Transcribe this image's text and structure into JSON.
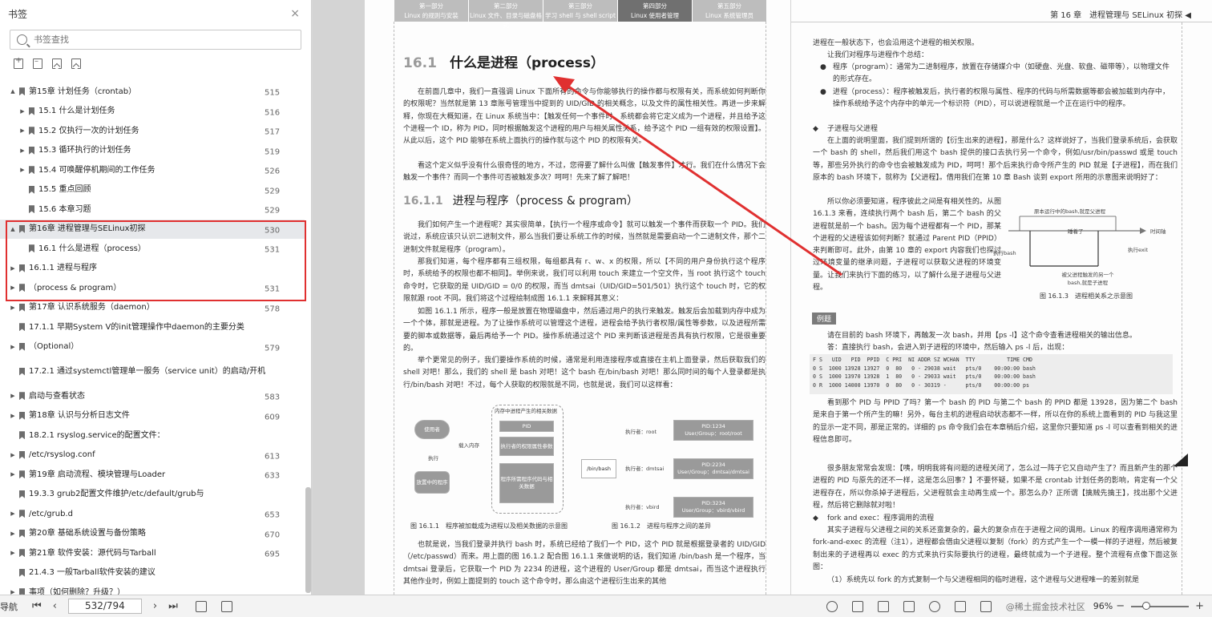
{
  "sidebar": {
    "title": "书签",
    "close_icon": "×",
    "search_placeholder": "书签查找",
    "toc": [
      {
        "title": "第15章 计划任务（crontab）",
        "page": "515",
        "level": 1,
        "twisty": "▲",
        "selected": false,
        "two": false
      },
      {
        "title": "15.1 什么是计划任务",
        "page": "516",
        "level": 2,
        "twisty": "▶",
        "selected": false,
        "two": false
      },
      {
        "title": "15.2 仅执行一次的计划任务",
        "page": "517",
        "level": 2,
        "twisty": "▶",
        "selected": false,
        "two": false
      },
      {
        "title": "15.3 循环执行的计划任务",
        "page": "519",
        "level": 2,
        "twisty": "▶",
        "selected": false,
        "two": false
      },
      {
        "title": "15.4 可唤醒停机期间的工作任务",
        "page": "526",
        "level": 2,
        "twisty": "▶",
        "selected": false,
        "two": false
      },
      {
        "title": "15.5 重点回顾",
        "page": "529",
        "level": 2,
        "twisty": "",
        "selected": false,
        "two": false
      },
      {
        "title": "15.6 本章习题",
        "page": "529",
        "level": 2,
        "twisty": "",
        "selected": false,
        "two": false
      },
      {
        "title": "第16章 进程管理与SELinux初探",
        "page": "530",
        "level": 1,
        "twisty": "▲",
        "selected": true,
        "two": false
      },
      {
        "title": "16.1 什么是进程（process）",
        "page": "531",
        "level": 2,
        "twisty": "",
        "selected": false,
        "two": false
      },
      {
        "title": "16.1.1 进程与程序",
        "page": "",
        "level": 1,
        "twisty": "▶",
        "selected": false,
        "two": false
      },
      {
        "title": "（process & program）",
        "page": "531",
        "level": 1,
        "twisty": "▶",
        "selected": false,
        "two": false
      },
      {
        "title": "第17章 认识系统服务（daemon）",
        "page": "578",
        "level": 1,
        "twisty": "▶",
        "selected": false,
        "two": false
      },
      {
        "title": "17.1.1 早期System V的init管理操作中daemon的主要分类",
        "page": "",
        "level": 1,
        "twisty": "",
        "selected": false,
        "two": false
      },
      {
        "title": "（Optional）",
        "page": "579",
        "level": 1,
        "twisty": "▶",
        "selected": false,
        "two": false
      },
      {
        "title": "17.2.1 通过systemctl管理单一服务（service unit）的启动/开机",
        "page": "",
        "level": 1,
        "twisty": "",
        "selected": false,
        "two": true
      },
      {
        "title": "启动与查看状态",
        "page": "583",
        "level": 1,
        "twisty": "▶",
        "selected": false,
        "two": false
      },
      {
        "title": "第18章 认识与分析日志文件",
        "page": "609",
        "level": 1,
        "twisty": "▶",
        "selected": false,
        "two": false
      },
      {
        "title": "18.2.1 rsyslog.service的配置文件：",
        "page": "",
        "level": 1,
        "twisty": "",
        "selected": false,
        "two": false
      },
      {
        "title": "/etc/rsyslog.conf",
        "page": "613",
        "level": 1,
        "twisty": "▶",
        "selected": false,
        "two": false
      },
      {
        "title": "第19章 启动流程、模块管理与Loader",
        "page": "633",
        "level": 1,
        "twisty": "▶",
        "selected": false,
        "two": false
      },
      {
        "title": "19.3.3 grub2配置文件维护/etc/default/grub与",
        "page": "",
        "level": 1,
        "twisty": "",
        "selected": false,
        "two": false
      },
      {
        "title": "/etc/grub.d",
        "page": "653",
        "level": 1,
        "twisty": "▶",
        "selected": false,
        "two": false
      },
      {
        "title": "第20章 基础系统设置与备份策略",
        "page": "670",
        "level": 1,
        "twisty": "▶",
        "selected": false,
        "two": false
      },
      {
        "title": "第21章 软件安装：源代码与Tarball",
        "page": "695",
        "level": 1,
        "twisty": "▶",
        "selected": false,
        "two": false
      },
      {
        "title": "21.4.3 一般Tarball软件安装的建议",
        "page": "",
        "level": 1,
        "twisty": "",
        "selected": false,
        "two": false
      },
      {
        "title": "事项（如何删除？升级？）",
        "page": "",
        "level": 1,
        "twisty": "▶",
        "selected": false,
        "two": false
      }
    ]
  },
  "left_page": {
    "parts": [
      {
        "a": "第一部分",
        "b": "Linux 的规则与安装",
        "active": false
      },
      {
        "a": "第二部分",
        "b": "Linux 文件、目录与磁盘格式",
        "active": false
      },
      {
        "a": "第三部分",
        "b": "学习 shell 与 shell script",
        "active": false
      },
      {
        "a": "第四部分",
        "b": "Linux 使用者管理",
        "active": true
      },
      {
        "a": "第五部分",
        "b": "Linux 系统管理员",
        "active": false
      }
    ],
    "h1_num": "16.1",
    "h1_text": "什么是进程（process）",
    "p1": "在前面几章中，我们一直强调 Linux 下面所有的命令与你能够执行的操作都与权限有关，而系统如何判断你的权限呢？当然就是第 13 章账号管理当中提到的 UID/GID 的相关概念，以及文件的属性相关性。再进一步来解释，你现在大概知道，在 Linux 系统当中：【触发任何一个事件时，系统都会将它定义成为一个进程，并且给予这个进程一个 ID，称为 PID，同时根据触发这个进程的用户与相关属性关系，给予这个 PID 一组有效的权限设置】。从此以后，这个 PID 能够在系统上面执行的操作就与这个 PID 的权限有关。",
    "p2": "看这个定义似乎没有什么很奇怪的地方，不过，您得要了解什么叫做【触发事件】才行。我们在什么情况下会触发一个事件？而同一个事件可否被触发多次？呵呵！先来了解了解吧！",
    "h2_num": "16.1.1",
    "h2_text": "进程与程序（process & program）",
    "p3": "我们如何产生一个进程呢？其实很简单，【执行一个程序或命令】就可以触发一个事件而获取一个 PID。我们说过，系统应该只认识二进制文件，那么当我们要让系统工作的时候，当然就是需要启动一个二进制文件，那个二进制文件就是程序（program）。",
    "p4": "那我们知道，每个程序都有三组权限，每组都具有 r、w、x 的权限，所以【不同的用户身份执行这个程序时，系统给予的权限也都不相同】。举例来说，我们可以利用 touch 来建立一个空文件，当 root 执行这个 touch 命令时，它获取的是 UID/GID = 0/0 的权限，而当 dmtsai（UID/GID=501/501）执行这个 touch 时，它的权限就跟 root 不同。我们将这个过程绘制成图 16.1.1 来解释其意义：",
    "p5": "如图 16.1.1 所示，程序一般是放置在物理磁盘中，然后通过用户的执行来触发。触发后会加载到内存中成为一个个体，那就是进程。为了让操作系统可以管理这个进程，进程会给予执行者权限/属性等参数，以及进程所需要的脚本或数据等，最后再给予一个 PID。操作系统通过这个 PID 来判断该进程是否具有执行权限，它是很重要的。",
    "p6": "举个更常见的例子，我们要操作系统的时候，通常是利用连接程序或直接在主机上面登录，然后获取我们的 shell 对吧！那么，我们的 shell 是 bash 对吧！这个 bash 在/bin/bash 对吧！那么同时间的每个人登录都是执行/bin/bash 对吧！不过，每个人获取的权限就是不同，也就是说，我们可以这样看：",
    "fig1": {
      "header": "内存中进程产生的相关数据",
      "use": "使用者",
      "exec": "执行",
      "load": "载入内存",
      "disk": "放置中的程序",
      "pid": "PID",
      "perm": "执行者的权限属性参数",
      "code": "程序所需程序代码与相关数据",
      "caption": "图 16.1.1　程序被加载成为进程以及相关数据的示意图"
    },
    "fig2": {
      "bash": "/bin/bash",
      "e1": "执行者：root",
      "e2": "执行者：dmtsai",
      "e3": "执行者：vbird",
      "b1": "PID:1234\nUser/Group：root/root",
      "b2": "PID:2234\nUser/Group：dmtsai/dmtsai",
      "b3": "PID:3234\nUser/Group：vbird/vbird",
      "caption": "图 16.1.2　进程与程序之间的差异"
    },
    "p7": "也就是说，当我们登录并执行 bash 时，系统已经给了我们一个 PID，这个 PID 就是根据登录者的 UID/GID（/etc/passwd）而来。用上面的图 16.1.2 配合图 16.1.1 来做说明的话，我们知道 /bin/bash 是一个程序，当 dmtsai 登录后，它获取一个 PID 为 2234 的进程，这个进程的 User/Group 都是 dmtsai，而当这个进程执行其他作业时，例如上面提到的 touch 这个命令时，那么由这个进程衍生出来的其他"
  },
  "right_page": {
    "header": "第 16 章　进程管理与 SELinux 初探 ◀",
    "r1": "进程在一般状态下，也会沿用这个进程的相关权限。",
    "r2": "让我们对程序与进程作个总结：",
    "b1": "程序（program）：通常为二进制程序，放置在存储媒介中（如硬盘、光盘、软盘、磁带等），以物理文件的形式存在。",
    "b2": "进程（process）：程序被触发后，执行者的权限与属性、程序的代码与所需数据等都会被加载到内存中，操作系统给予这个内存中的单元一个标识符（PID），可以说进程就是一个正在运行中的程序。",
    "s1": "子进程与父进程",
    "r3": "在上面的说明里面，我们提到所谓的【衍生出来的进程】，那是什么？这样说好了，当我们登录系统后，会获取一个 bash 的 shell，然后我们用这个 bash 提供的接口去执行另一个命令，例如/usr/bin/passwd 或是 touch 等，那些另外执行的命令也会被触发成为 PID，呵呵！那个后来执行命令所产生的 PID 就是【子进程】，而在我们原本的 bash 环境下，就称为【父进程】。借用我们在第 10 章 Bash 谈到 export 所用的示意图来说明好了：",
    "r4": "所以你必须要知道，程序彼此之间是有相关性的。从图 16.1.3 来看，连续执行两个 bash 后，第二个 bash 的父进程就是前一个 bash。因为每个进程都有一个 PID，那某个进程的父进程该如何判断？就通过 Parent PID（PPID）来判断即可。此外，由第 10 章的 export 内容我们也探讨过环境变量的继承问题，子进程可以获取父进程的环境变量。让我们来执行下面的练习，以了解什么是子进程与父进程。",
    "fig3": {
      "top": "原本运行中的bash,就是父进程",
      "sleep": "睡着了",
      "time": "时间轴",
      "exec": "执行bash",
      "exit": "执行exit",
      "bottom": "被父进程触发的另一个bash,就是子进程",
      "caption": "图 16.1.3　进程相关系之示意图"
    },
    "example_tag": "例题",
    "ex_q": "请在目前的 bash 环境下，再触发一次 bash，并用【ps -l】这个命令查看进程相关的输出信息。",
    "ex_a": "答：直接执行 bash，会进入到子进程的环境中，然后输入 ps -l 后，出现：",
    "code_lines": [
      "F S   UID   PID  PPID  C PRI  NI ADDR SZ WCHAN  TTY          TIME CMD",
      "0 S  1000 13928 13927  0  80   0 - 29038 wait   pts/0    00:00:00 bash",
      "0 S  1000 13970 13928  1  80   0 - 29033 wait   pts/0    00:00:00 bash",
      "0 R  1000 14000 13970  0  80   0 - 30319 -      pts/0    00:00:00 ps"
    ],
    "r5": "看到那个 PID 与 PPID 了吗？第一个 bash 的 PID 与第二个 bash 的 PPID 都是 13928，因为第二个 bash 是来自于第一个所产生的嘛！另外，每台主机的进程启动状态都不一样，所以在你的系统上面看到的 PID 与我这里的显示一定不同，那是正常的。详细的 ps 命令我们会在本章稍后介绍，这里你只要知道 ps -l 可以查看到相关的进程信息即可。",
    "r6": "很多朋友常常会发现：【咦，明明我将有问题的进程关闭了，怎么过一阵子它又自动产生了？而且新产生的那个进程的 PID 与原先的还不一样，这是怎么回事？】不要怀疑，如果不是 crontab 计划任务的影响，肯定有一个父进程存在，所以你杀掉子进程后，父进程就会主动再生成一个。那怎么办？正所谓【擒贼先擒王】，找出那个父进程，然后将它删除就对啦！",
    "s2": "fork and exec：程序调用的流程",
    "r7": "其实子进程与父进程之间的关系还蛮复杂的，最大的复杂点在于进程之间的调用。Linux 的程序调用通常称为 fork-and-exec 的流程（注1），进程都会借由父进程以复制（fork）的方式产生一个一模一样的子进程，然后被复制出来的子进程再以 exec 的方式来执行实际要执行的进程，最终就成为一个子进程。整个流程有点像下面这张图：",
    "r8": "（1）系统先以 fork 的方式复制一个与父进程相同的临时进程，这个进程与父进程唯一的差别就是"
  },
  "statusbar": {
    "left_label": "导航",
    "page_display": "532/794",
    "zoom": "96%",
    "watermark": "@稀土掘金技术社区"
  },
  "colors": {
    "highlight": "#e03030",
    "arrow": "#e03030"
  }
}
